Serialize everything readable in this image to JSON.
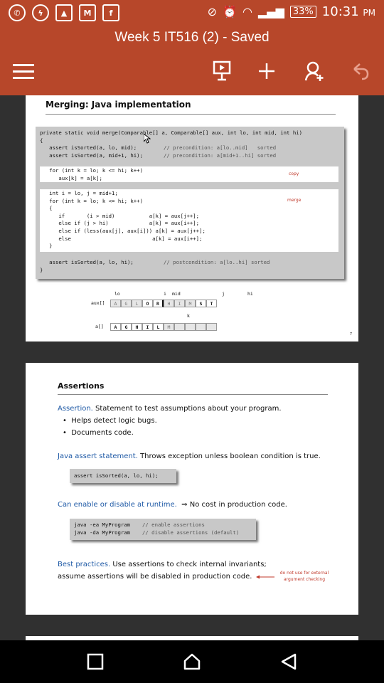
{
  "status": {
    "battery": "33%",
    "time": "10:31",
    "ampm": "PM"
  },
  "app": {
    "title": "Week 5 IT516 (2) - Saved"
  },
  "slide1": {
    "title": "Merging:  Java implementation",
    "code_lines": [
      "private static void merge(Comparable[] a, Comparable[] aux, int lo, int mid, int hi)",
      "{",
      "   assert isSorted(a, lo, mid);",
      "   assert isSorted(a, mid+1, hi);"
    ],
    "comments": [
      "// precondition: a[lo..mid]   sorted",
      "// precondition: a[mid+1..hi] sorted"
    ],
    "copy_lines": [
      "   for (int k = lo; k <= hi; k++)",
      "      aux[k] = a[k];"
    ],
    "copy_label": "copy",
    "merge_lines": [
      "   int i = lo, j = mid+1;",
      "   for (int k = lo; k <= hi; k++)",
      "   {",
      "      if       (i > mid)           a[k] = aux[j++];",
      "      else if (j > hi)             a[k] = aux[i++];",
      "      else if (less(aux[j], aux[i])) a[k] = aux[j++];",
      "      else                          a[k] = aux[i++];",
      "   }"
    ],
    "merge_label": "merge",
    "assert_line": "   assert isSorted(a, lo, hi);",
    "assert_comment": "// postcondition: a[lo..hi] sorted",
    "close_brace": "}",
    "labels": {
      "lo": "lo",
      "i": "i",
      "mid": "mid",
      "j": "j",
      "hi": "hi",
      "k": "k"
    },
    "aux_label": "aux[]",
    "a_label": "a[]",
    "aux_cells": [
      "A",
      "G",
      "L",
      "O",
      "R",
      "H",
      "I",
      "M",
      "S",
      "T"
    ],
    "a_cells": [
      "A",
      "G",
      "H",
      "I",
      "L",
      "M",
      "",
      "",
      "",
      ""
    ],
    "page_num": "7"
  },
  "slide2": {
    "title": "Assertions",
    "assertion_term": "Assertion.",
    "assertion_text": " Statement to test assumptions about your program.",
    "bullets": [
      "Helps detect logic bugs.",
      "Documents code."
    ],
    "java_term": "Java assert statement.",
    "java_text": " Throws exception unless boolean condition is true.",
    "code1": "assert isSorted(a, lo, hi);",
    "enable_term": "Can enable or disable at runtime.",
    "enable_text": "No cost in production code.",
    "code2_line1": "java -ea MyProgram",
    "code2_c1": "// enable assertions",
    "code2_line2": "java -da MyProgram",
    "code2_c2": "// disable assertions (default)",
    "best_term": "Best practices.",
    "best_text": " Use assertions to check internal invariants;",
    "best_line2": "assume assertions will be disabled in production code.",
    "note_line1": "do not use for external",
    "note_line2": "argument checking"
  },
  "icons": {
    "accent": "#b7472a"
  }
}
